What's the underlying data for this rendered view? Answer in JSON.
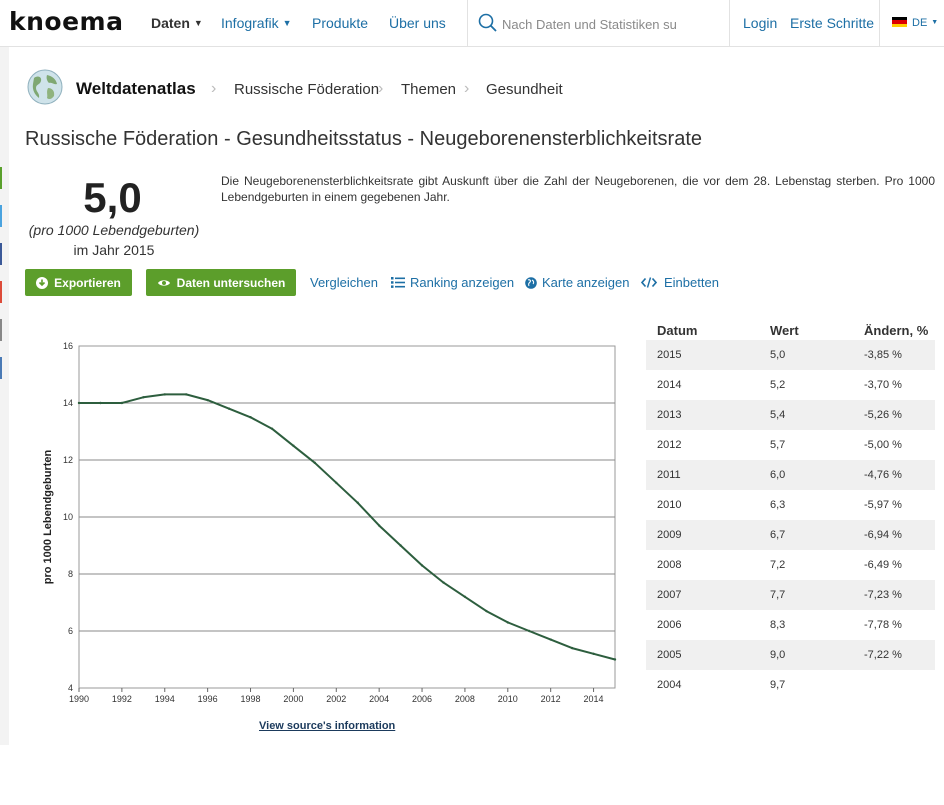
{
  "nav": {
    "logo": "knoema",
    "items": [
      {
        "label": "Daten",
        "caret": true,
        "active": true
      },
      {
        "label": "Infografik",
        "caret": true,
        "active": false
      },
      {
        "label": "Produkte",
        "caret": false,
        "active": false
      },
      {
        "label": "Über uns",
        "caret": false,
        "active": false
      }
    ],
    "search_placeholder": "Nach Daten und Statistiken su",
    "login": "Login",
    "first_steps": "Erste Schritte",
    "lang": "DE"
  },
  "breadcrumb": [
    "Weltdatenatlas",
    "Russische Föderation",
    "Themen",
    "Gesundheit"
  ],
  "page_title": "Russische Föderation - Gesundheitsstatus - Neugeborenensterblichkeitsrate",
  "summary": {
    "value": "5,0",
    "unit": "(pro 1000 Lebendgeburten)",
    "year": "im Jahr 2015"
  },
  "description": "Die Neugeborenensterblichkeitsrate gibt Auskunft über die Zahl der Neugeborenen, die vor dem 28. Lebenstag sterben. Pro 1000 Lebendgeburten in einem gegebenen Jahr.",
  "actions": {
    "export": "Exportieren",
    "explore": "Daten untersuchen",
    "compare": "Vergleichen",
    "ranking": "Ranking anzeigen",
    "map": "Karte anzeigen",
    "embed": "Einbetten"
  },
  "source_link": "View source's information",
  "table": {
    "headers": [
      "Datum",
      "Wert",
      "Ändern, %"
    ],
    "rows": [
      [
        "2015",
        "5,0",
        "-3,85 %"
      ],
      [
        "2014",
        "5,2",
        "-3,70 %"
      ],
      [
        "2013",
        "5,4",
        "-5,26 %"
      ],
      [
        "2012",
        "5,7",
        "-5,00 %"
      ],
      [
        "2011",
        "6,0",
        "-4,76 %"
      ],
      [
        "2010",
        "6,3",
        "-5,97 %"
      ],
      [
        "2009",
        "6,7",
        "-6,94 %"
      ],
      [
        "2008",
        "7,2",
        "-6,49 %"
      ],
      [
        "2007",
        "7,7",
        "-7,23 %"
      ],
      [
        "2006",
        "8,3",
        "-7,78 %"
      ],
      [
        "2005",
        "9,0",
        "-7,22 %"
      ],
      [
        "2004",
        "9,7",
        ""
      ]
    ]
  },
  "colors": {
    "accent_green": "#5c9e2b",
    "link_blue": "#1d6fa5",
    "line": "#2d5e3e"
  },
  "chart_data": {
    "type": "line",
    "ylabel": "pro 1000 Lebendgeburten",
    "xlabel": "",
    "xlim": [
      1990,
      2015
    ],
    "ylim": [
      4,
      16
    ],
    "xticks": [
      "1990",
      "1992",
      "1994",
      "1996",
      "1998",
      "2000",
      "2002",
      "2004",
      "2006",
      "2008",
      "2010",
      "2012",
      "2014"
    ],
    "yticks": [
      "4",
      "6",
      "8",
      "10",
      "12",
      "14",
      "16"
    ],
    "grid": true,
    "series": [
      {
        "x": [
          1990,
          1991,
          1992,
          1993,
          1994,
          1995,
          1996,
          1997,
          1998,
          1999,
          2000,
          2001,
          2002,
          2003,
          2004,
          2005,
          2006,
          2007,
          2008,
          2009,
          2010,
          2011,
          2012,
          2013,
          2014,
          2015
        ],
        "y": [
          14.0,
          14.0,
          14.0,
          14.2,
          14.3,
          14.3,
          14.1,
          13.8,
          13.5,
          13.1,
          12.5,
          11.9,
          11.2,
          10.5,
          9.7,
          9.0,
          8.3,
          7.7,
          7.2,
          6.7,
          6.3,
          6.0,
          5.7,
          5.4,
          5.2,
          5.0
        ]
      }
    ]
  }
}
